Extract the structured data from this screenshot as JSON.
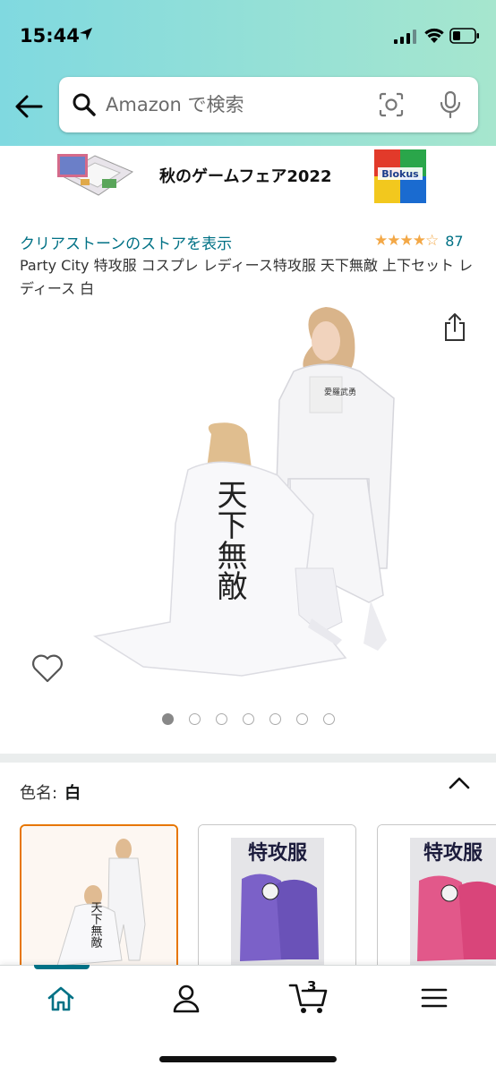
{
  "status_bar": {
    "time": "15:44"
  },
  "search": {
    "placeholder": "Amazon で検索"
  },
  "banner": {
    "title": "秋のゲームフェア2022",
    "thumb2_text": "Blokus"
  },
  "product": {
    "store_link": "クリアストーンのストアを表示",
    "rating_stars": "★★★★☆",
    "rating_count": "87",
    "title": "Party City 特攻服 コスプレ レディース特攻服 天下無敵 上下セット レディース 白",
    "back_text": "天下無敵",
    "chest_text": "愛羅武勇"
  },
  "gallery": {
    "image_count": 7,
    "active_index": 0
  },
  "color": {
    "label": "色名:",
    "value": "白"
  },
  "swatches": [
    {
      "name": "white",
      "text": "天下無敵"
    },
    {
      "name": "purple",
      "text": "特攻服"
    },
    {
      "name": "pink",
      "text": "特攻服"
    }
  ],
  "nav": {
    "cart_count": "3"
  },
  "colors": {
    "accent": "#007185",
    "star": "#f3a847",
    "selected_border": "#e77600"
  }
}
